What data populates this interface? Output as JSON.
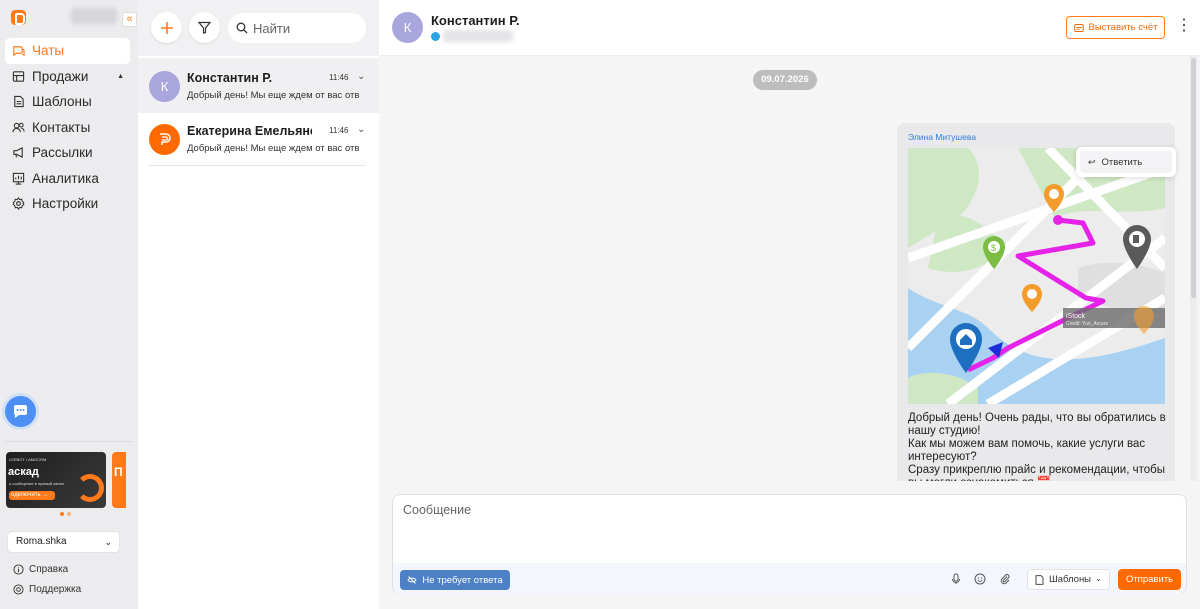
{
  "app": {
    "collapse_icon": "«",
    "accent_color": "#ff7a1a"
  },
  "sidebar": {
    "items": [
      {
        "label": "Чаты",
        "icon": "chats-icon",
        "active": true
      },
      {
        "label": "Продажи",
        "icon": "sales-icon",
        "expandable": true
      },
      {
        "label": "Шаблоны",
        "icon": "templates-icon"
      },
      {
        "label": "Контакты",
        "icon": "contacts-icon"
      },
      {
        "label": "Рассылки",
        "icon": "broadcast-icon"
      },
      {
        "label": "Аналитика",
        "icon": "analytics-icon"
      },
      {
        "label": "Настройки",
        "icon": "settings-icon"
      }
    ],
    "banner": {
      "badge": "LEEBOT • AMOCRM",
      "title": "аскад",
      "subtitle": "о-сообщение в нужный канал",
      "button": "одключить →"
    },
    "banner2_title": "П",
    "account": "Roma.shka",
    "help": "Справка",
    "support": "Поддержка"
  },
  "chat_list": {
    "search_placeholder": "Найти",
    "chats": [
      {
        "name": "Константин Р.",
        "initial": "К",
        "time": "11:46",
        "preview": "Добрый день! Мы еще ждем от вас отв",
        "avatar_color": "#a9a5dd",
        "active": true
      },
      {
        "name": "Екатерина Емельянова",
        "initial": "",
        "time": "11:46",
        "preview": "Добрый день! Мы еще ждем от вас отв",
        "avatar_color": "#ff6a00",
        "active": false
      }
    ]
  },
  "conversation": {
    "contact_name": "Константин Р.",
    "contact_initial": "К",
    "invoice_button": "Выставить счёт",
    "date": "09.07.2026",
    "message": {
      "sender": "Элина Митушева",
      "text": "Добрый день! Очень рады, что вы обратились в нашу студию!\nКак мы можем вам помочь, какие услуги вас интересуют?\nСразу прикреплю прайс и рекомендации, чтобы вы могли ознакомиться 📅",
      "image_watermark": "iStock",
      "image_credit": "Credit: Yuri_Arcurs"
    },
    "reply_menu": "Ответить",
    "composer": {
      "placeholder": "Сообщение",
      "no_reply_button": "Не требует ответа",
      "templates_button": "Шаблоны",
      "send_button": "Отправить"
    }
  }
}
